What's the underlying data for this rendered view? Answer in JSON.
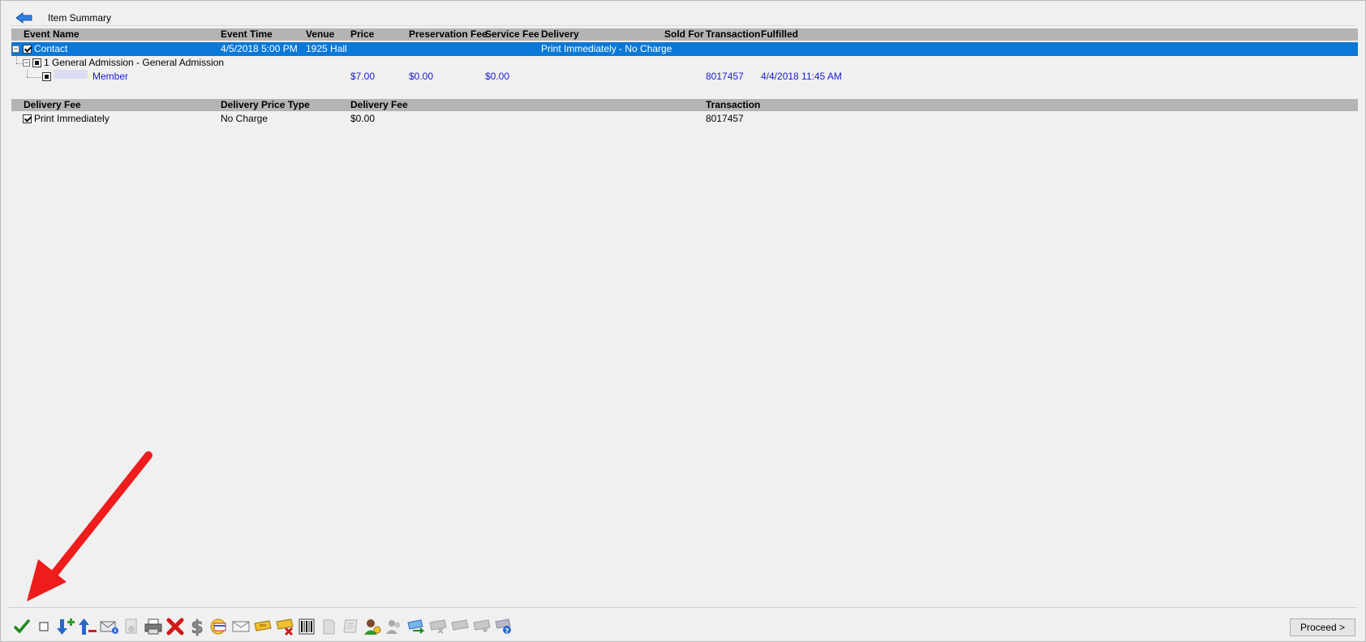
{
  "header": {
    "title": "Item Summary"
  },
  "items_grid": {
    "columns": [
      "Event Name",
      "Event Time",
      "Venue",
      "Price",
      "Preservation Fee",
      "Service Fee",
      "Delivery",
      "Sold For",
      "Transaction",
      "Fulfilled"
    ],
    "event_row": {
      "event_name": "Contact",
      "event_time": "4/5/2018 5:00 PM",
      "venue": "1925 Hall",
      "delivery": "Print Immediately - No Charge"
    },
    "section_row": {
      "label": "1 General Admission - General Admission"
    },
    "ticket_row": {
      "name": "Member",
      "price": "$7.00",
      "preservation_fee": "$0.00",
      "service_fee": "$0.00",
      "transaction": "8017457",
      "fulfilled": "4/4/2018 11:45 AM"
    }
  },
  "delivery_grid": {
    "columns": [
      "Delivery Fee",
      "Delivery Price Type",
      "Delivery Fee",
      "Transaction"
    ],
    "row": {
      "delivery_fee_name": "Print Immediately",
      "price_type": "No Charge",
      "fee": "$0.00",
      "transaction": "8017457"
    }
  },
  "toolbar": {
    "icons": [
      "check-all-icon",
      "uncheck-all-icon",
      "add-down-icon",
      "remove-up-icon",
      "email-info-icon",
      "document-info-icon",
      "printer-icon",
      "delete-icon",
      "dollar-icon",
      "payment-card-icon",
      "envelope-icon",
      "ticket-icon",
      "ticket-remove-icon",
      "barcode-icon",
      "document-icon",
      "scroll-icon",
      "user-assign-icon",
      "users-icon",
      "ticket-exchange-icon",
      "ticket-gray-1-icon",
      "ticket-gray-2-icon",
      "ticket-gray-3-icon",
      "ticket-help-icon"
    ]
  },
  "actions": {
    "proceed_label": "Proceed >"
  },
  "colors": {
    "selected_row": "#0a78d7",
    "header_bg": "#b4b4b4",
    "link_text": "#1a1ad2",
    "annotation_arrow": "#ee1c1c"
  }
}
